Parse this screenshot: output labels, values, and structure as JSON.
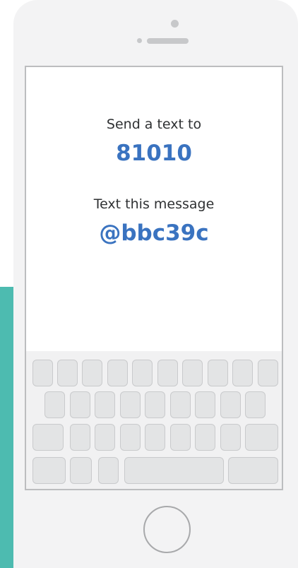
{
  "instructions": {
    "send_label": "Send a text to",
    "phone_number": "81010",
    "message_label": "Text this message",
    "message_code": "@bbc39c"
  },
  "colors": {
    "accent": "#3a73c0",
    "text": "#2f3133",
    "teal": "#4dbbb0",
    "key_fill": "#e3e4e5",
    "key_border": "#c9cacc"
  }
}
